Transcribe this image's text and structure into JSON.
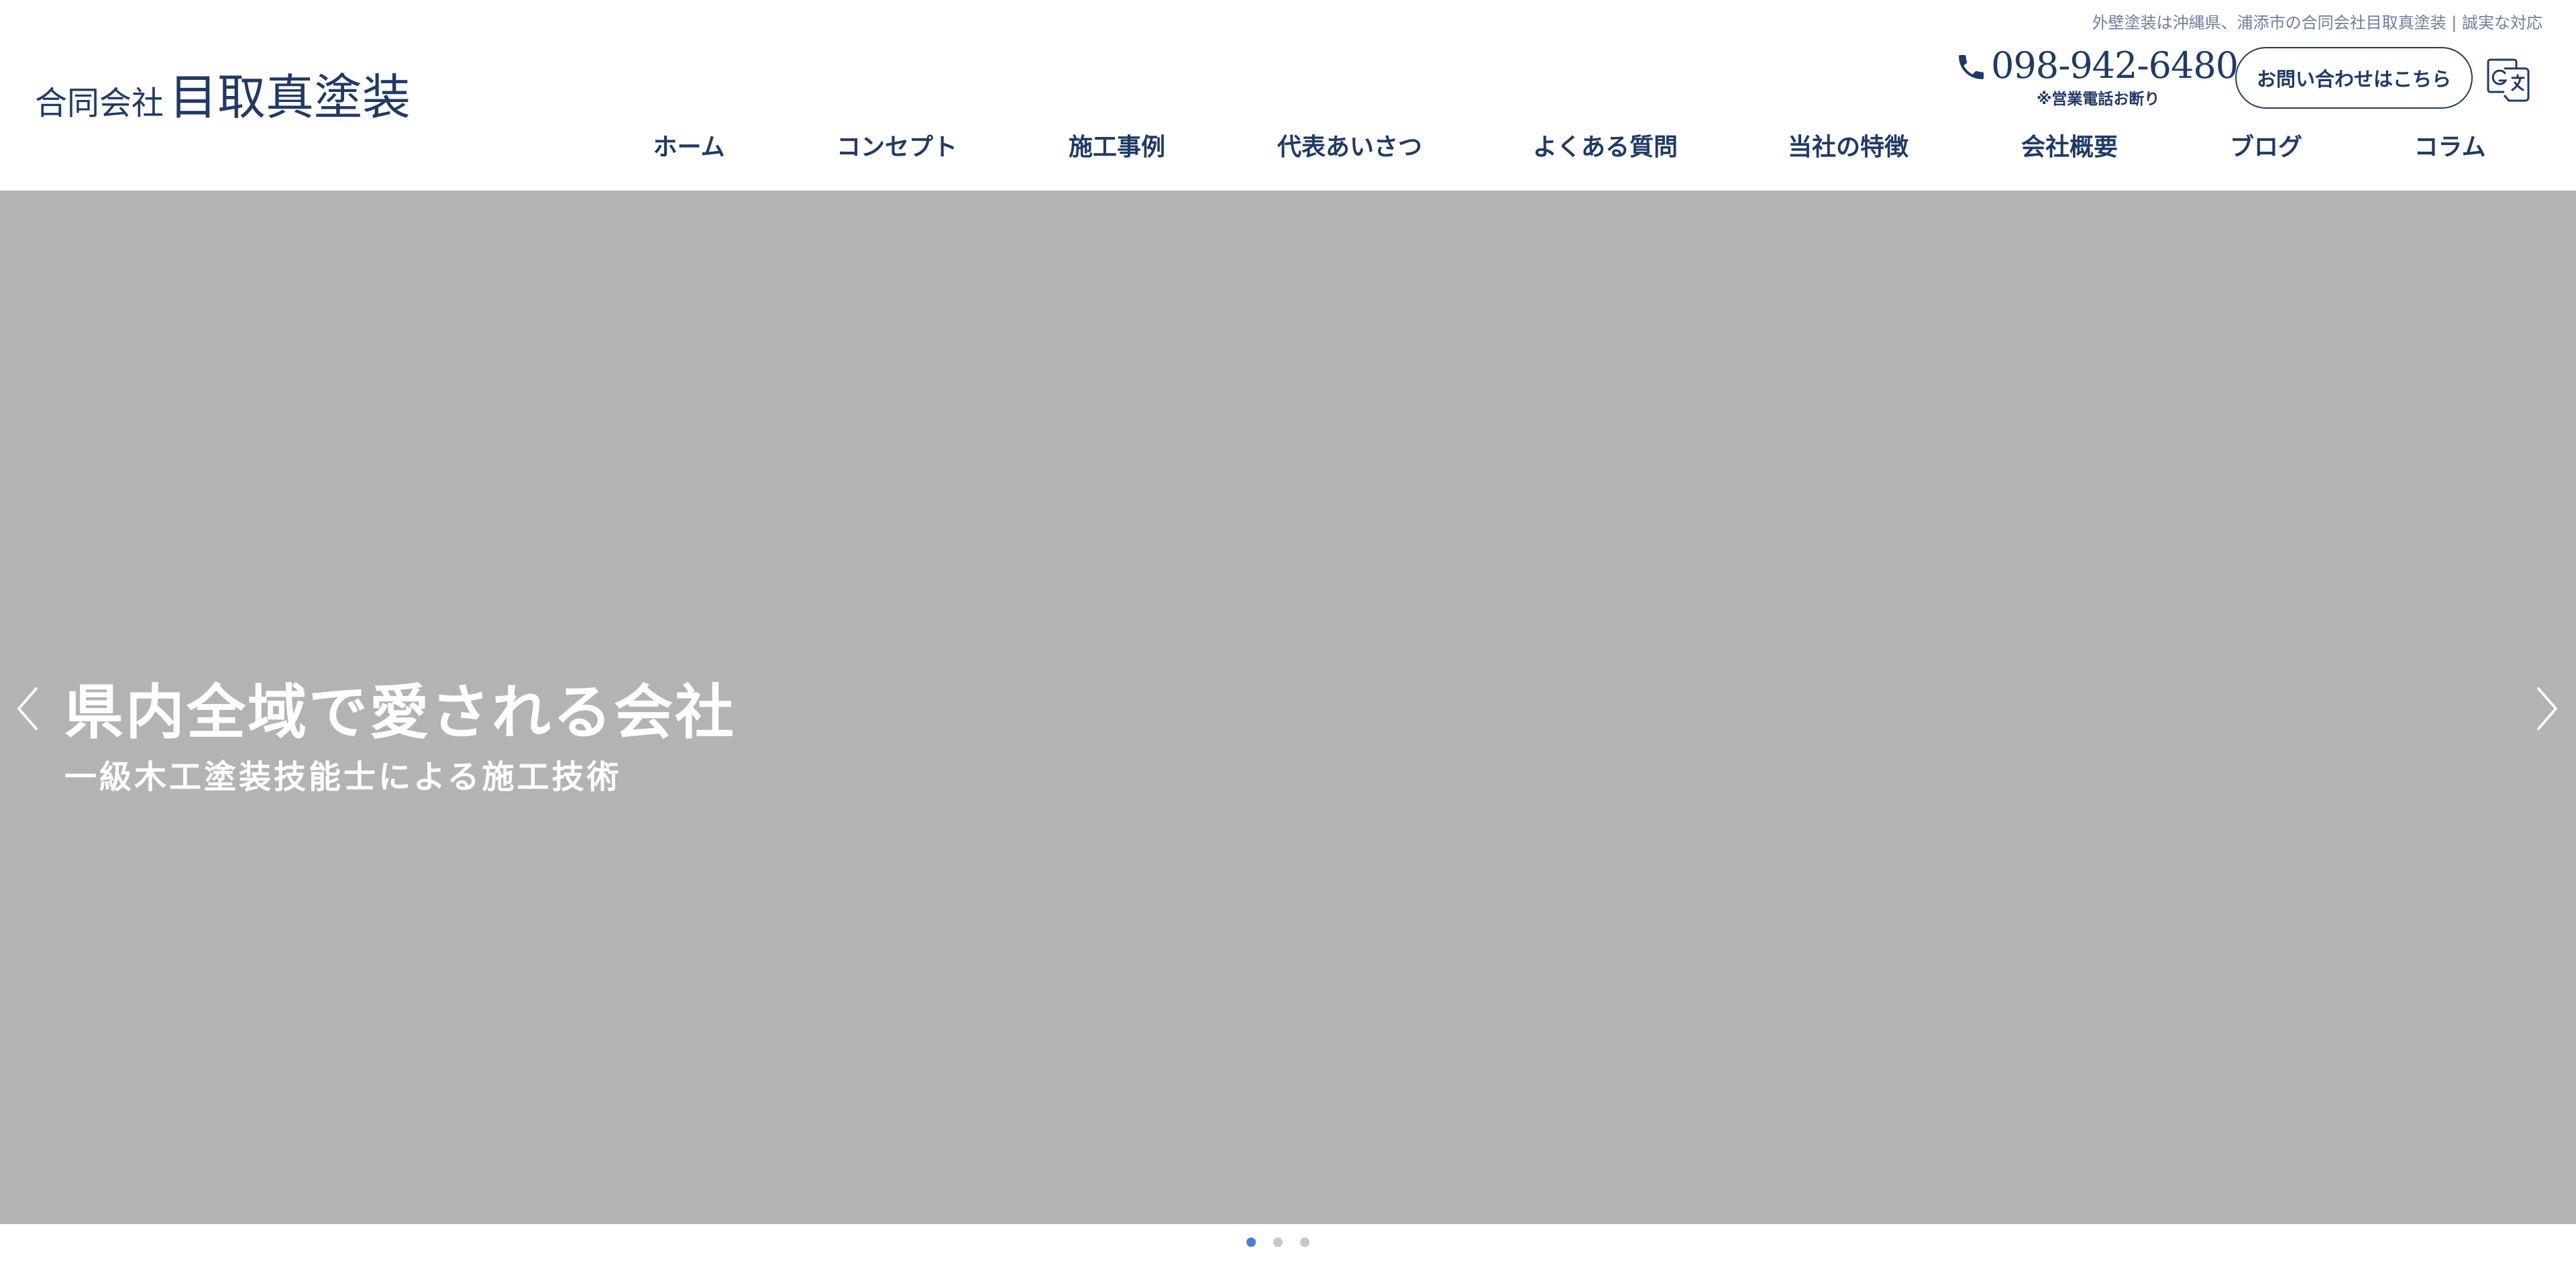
{
  "header": {
    "tagline": "外壁塗装は沖縄県、浦添市の合同会社目取真塗装 | 誠実な対応",
    "logo": {
      "prefix": "合同会社",
      "name": "目取真塗装"
    },
    "phone": {
      "icon": "phone-icon",
      "number": "098-942-6480",
      "note": "※営業電話お断り"
    },
    "contact_button": "お問い合わせはこちら",
    "translate_icon": "google-translate-icon"
  },
  "nav": {
    "items": [
      {
        "label": "ホーム"
      },
      {
        "label": "コンセプト"
      },
      {
        "label": "施工事例"
      },
      {
        "label": "代表あいさつ"
      },
      {
        "label": "よくある質問"
      },
      {
        "label": "当社の特徴"
      },
      {
        "label": "会社概要"
      },
      {
        "label": "ブログ"
      },
      {
        "label": "コラム"
      }
    ]
  },
  "slider": {
    "title": "県内全域で愛される会社",
    "subtitle": "一級木工塗装技能士による施工技術",
    "prev_icon": "chevron-left-icon",
    "next_icon": "chevron-right-icon",
    "slide_count": 3,
    "active_index": 0
  },
  "colors": {
    "brand_navy": "#203a66",
    "slide_background": "#b3b3b3",
    "active_dot": "#4a7fd0",
    "inactive_dot": "#c7c7c7"
  }
}
